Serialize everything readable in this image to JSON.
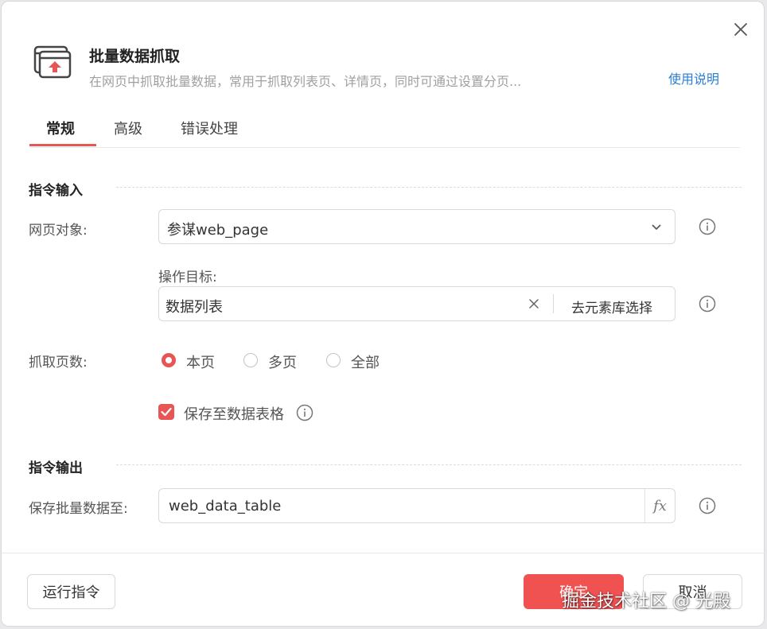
{
  "header": {
    "title": "批量数据抓取",
    "subtitle": "在网页中抓取批量数据，常用于抓取列表页、详情页，同时可通过设置分页...",
    "help_link": "使用说明"
  },
  "tabs": [
    {
      "label": "常规",
      "active": true
    },
    {
      "label": "高级",
      "active": false
    },
    {
      "label": "错误处理",
      "active": false
    }
  ],
  "input_section": {
    "title": "指令输入",
    "web_object": {
      "label": "网页对象:",
      "value": "参谋web_page"
    },
    "target": {
      "label": "操作目标:",
      "value": "数据列表",
      "select_button": "去元素库选择"
    },
    "pages": {
      "label": "抓取页数:",
      "options": [
        {
          "label": "本页",
          "checked": true
        },
        {
          "label": "多页",
          "checked": false
        },
        {
          "label": "全部",
          "checked": false
        }
      ]
    },
    "save_to_table": {
      "label": "保存至数据表格",
      "checked": true
    }
  },
  "output_section": {
    "title": "指令输出",
    "save_to": {
      "label": "保存批量数据至:",
      "value": "web_data_table",
      "fx_label": "fx"
    }
  },
  "footer": {
    "run_button": "运行指令",
    "confirm_button": "确定",
    "cancel_button": "取消"
  },
  "watermark": "掘金技术社区 @ 光殿",
  "colors": {
    "accent": "#e85555",
    "link": "#2a7ed6"
  }
}
